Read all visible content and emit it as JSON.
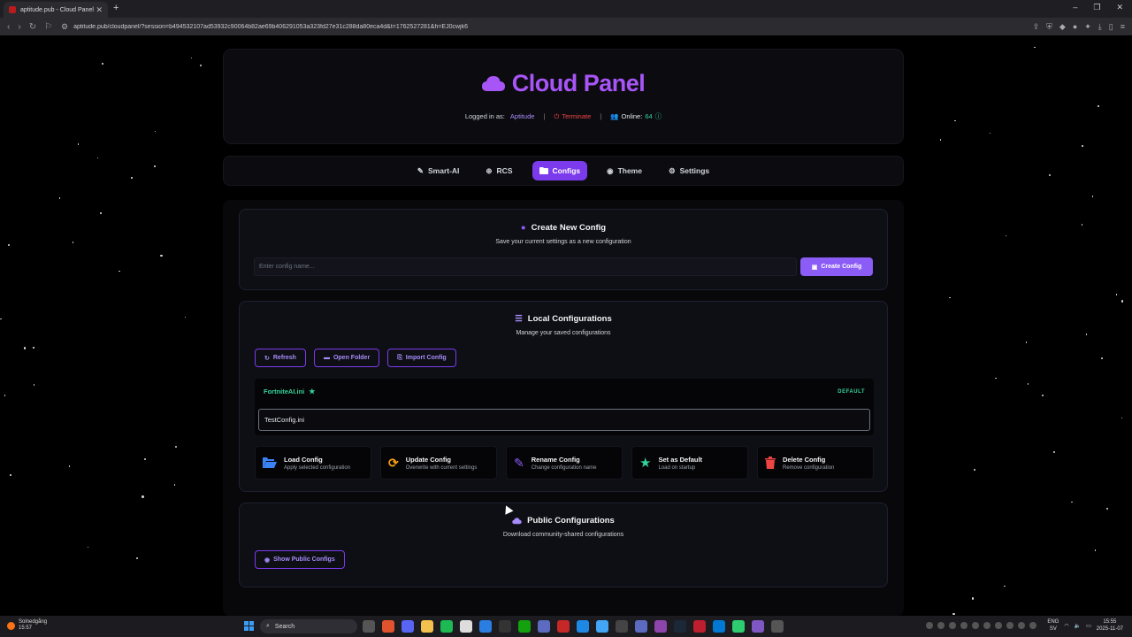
{
  "browser": {
    "tab_title": "aptitude.pub - Cloud Panel",
    "tab_close": "✕",
    "new_tab": "+",
    "url": "aptitude.pub/cloudpanel/?session=b494532107ad53932c90064b82ae69b406291053a323fd27e31c288da80eca4d&t=1762527281&h=EJ0cwjk6"
  },
  "header": {
    "title": "Cloud Panel",
    "logged_in_label": "Logged in as:",
    "username": "Aptitude",
    "terminate": "Terminate",
    "online_label": "Online:",
    "online_count": "64"
  },
  "nav": {
    "items": [
      {
        "label": "Smart-AI",
        "icon": "wand-icon"
      },
      {
        "label": "RCS",
        "icon": "crosshair-icon"
      },
      {
        "label": "Configs",
        "icon": "folder-icon",
        "active": true
      },
      {
        "label": "Theme",
        "icon": "palette-icon"
      },
      {
        "label": "Settings",
        "icon": "gear-icon"
      }
    ]
  },
  "create": {
    "title": "Create New Config",
    "subtitle": "Save your current settings as a new configuration",
    "placeholder": "Enter config name...",
    "button": "Create Config"
  },
  "local": {
    "title": "Local Configurations",
    "subtitle": "Manage your saved configurations",
    "buttons": {
      "refresh": "Refresh",
      "open_folder": "Open Folder",
      "import": "Import Config"
    },
    "configs": [
      {
        "name": "FortniteAI.ini",
        "badge": "DEFAULT"
      },
      {
        "name": "TestConfig.ini"
      }
    ],
    "actions": [
      {
        "title": "Load Config",
        "sub": "Apply selected configuration",
        "icon": "folder-open-icon",
        "color": "#3b82f6"
      },
      {
        "title": "Update Config",
        "sub": "Overwrite with current settings",
        "icon": "sync-icon",
        "color": "#f59e0b"
      },
      {
        "title": "Rename Config",
        "sub": "Change configuration name",
        "icon": "edit-icon",
        "color": "#8b5cf6"
      },
      {
        "title": "Set as Default",
        "sub": "Load on startup",
        "icon": "star-icon",
        "color": "#34d399"
      },
      {
        "title": "Delete Config",
        "sub": "Remove configuration",
        "icon": "trash-icon",
        "color": "#ef4444"
      }
    ]
  },
  "public": {
    "title": "Public Configurations",
    "subtitle": "Download community-shared configurations",
    "button": "Show Public Configs"
  },
  "taskbar": {
    "weather_label": "Solnedgång",
    "weather_time": "15:57",
    "search": "Search",
    "lang1": "ENG",
    "lang2": "SV",
    "time": "15:55",
    "date": "2025-11-07"
  },
  "colors": {
    "accent": "#8b5cf6",
    "success": "#34d399",
    "danger": "#ef4444"
  }
}
